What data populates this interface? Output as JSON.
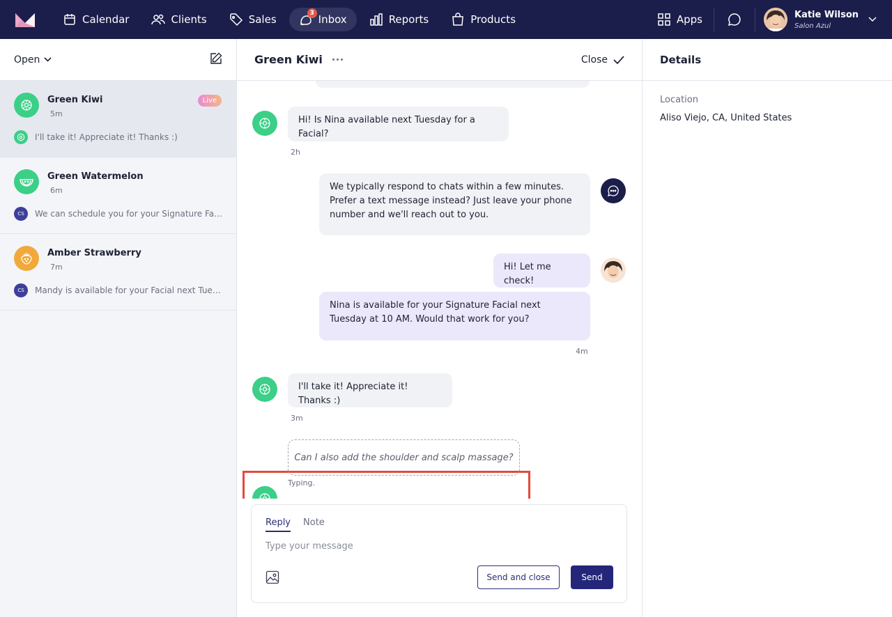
{
  "nav": {
    "items": [
      {
        "label": "Calendar",
        "icon": "calendar-icon"
      },
      {
        "label": "Clients",
        "icon": "users-icon"
      },
      {
        "label": "Sales",
        "icon": "tag-icon"
      },
      {
        "label": "Inbox",
        "icon": "inbox-icon",
        "badge": "3"
      },
      {
        "label": "Reports",
        "icon": "bar-chart-icon"
      },
      {
        "label": "Products",
        "icon": "bag-icon"
      }
    ],
    "apps_label": "Apps",
    "user": {
      "name": "Katie Wilson",
      "org": "Salon Azul"
    }
  },
  "sidebar": {
    "filter_label": "Open",
    "conversations": [
      {
        "name": "Green Kiwi",
        "time": "5m",
        "badge": "Live",
        "preview": "I'll take it! Appreciate it! Thanks :)",
        "avatar_color": "#3bcf88"
      },
      {
        "name": "Green Watermelon",
        "time": "6m",
        "preview": "We can schedule you for your Signature Fac...",
        "avatar_color": "#3bcf88",
        "preview_initials": "CS"
      },
      {
        "name": "Amber Strawberry",
        "time": "7m",
        "preview": "Mandy is available for your Facial next Tues...",
        "avatar_color": "#f2a93b",
        "preview_initials": "CS"
      }
    ]
  },
  "conversation": {
    "title": "Green Kiwi",
    "close_label": "Close",
    "messages": [
      {
        "text": "Hi! Is Nina available next Tuesday for a Facial?",
        "time": "2h"
      },
      {
        "text": "We typically respond to chats within a few minutes. Prefer a text message instead? Just leave your phone number and we'll reach out to you."
      },
      {
        "text": "Hi! Let me check!"
      },
      {
        "text": "Nina is available for your Signature Facial next Tuesday at 10 AM. Would that work for you?",
        "time": "4m"
      },
      {
        "text": "I'll take it! Appreciate it! Thanks :)",
        "time": "3m"
      }
    ],
    "typing": {
      "text": "Can I also add the shoulder and scalp massage?",
      "status": "Typing."
    }
  },
  "composer": {
    "tabs": [
      "Reply",
      "Note"
    ],
    "placeholder": "Type your message",
    "send_close_label": "Send and close",
    "send_label": "Send"
  },
  "details": {
    "title": "Details",
    "location_label": "Location",
    "location_value": "Aliso Viejo, CA, United States"
  },
  "colors": {
    "nav_bg": "#1b1d4b",
    "accent": "#24267a",
    "customer_green": "#3bcf88",
    "highlight_border": "#e24a3b"
  }
}
